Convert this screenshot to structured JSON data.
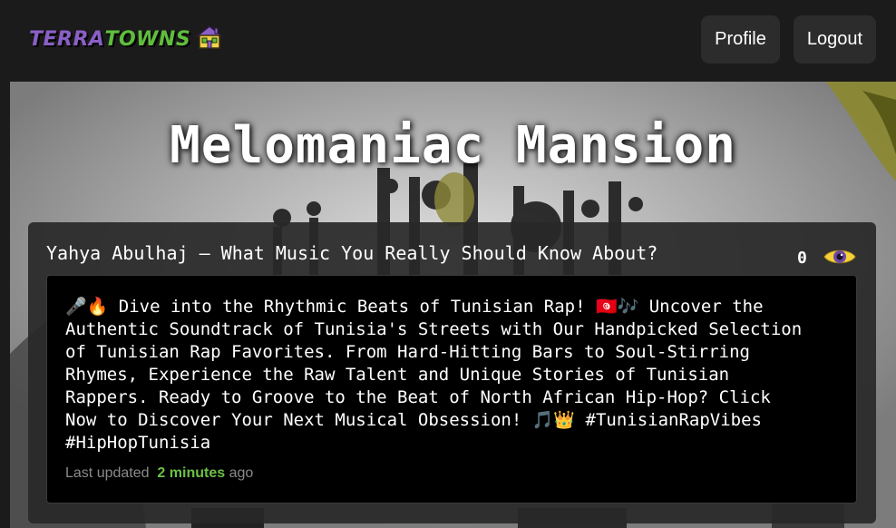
{
  "header": {
    "logo_part1": "TERRA",
    "logo_part2": "TOWNS",
    "logo_icon": "house-icon",
    "profile_label": "Profile",
    "logout_label": "Logout"
  },
  "hero": {
    "title": "Melomaniac Mansion"
  },
  "post": {
    "title": "Yahya Abulhaj — What Music You Really Should Know About?",
    "view_count": "0",
    "view_icon": "eye-icon",
    "body_lines": [
      "🎤🔥 Dive into the Rhythmic Beats of Tunisian Rap! 🇹🇳🎶 Uncover the",
      "Authentic Soundtrack of Tunisia's Streets with Our Handpicked Selection",
      "of Tunisian Rap Favorites. From Hard-Hitting Bars to Soul-Stirring",
      "Rhymes, Experience the Raw Talent and Unique Stories of Tunisian",
      "Rappers. Ready to Groove to the Beat of North African Hip-Hop? Click",
      "Now to Discover Your Next Musical Obsession! 🎵👑 #TunisianRapVibes",
      "#HipHopTunisia"
    ],
    "last_updated_prefix": "Last updated",
    "last_updated_time": "2 minutes",
    "last_updated_suffix": "ago"
  },
  "colors": {
    "accent_purple": "#8a5fc6",
    "accent_green": "#5fbe3d",
    "eye_yellow": "#f4d13a"
  }
}
